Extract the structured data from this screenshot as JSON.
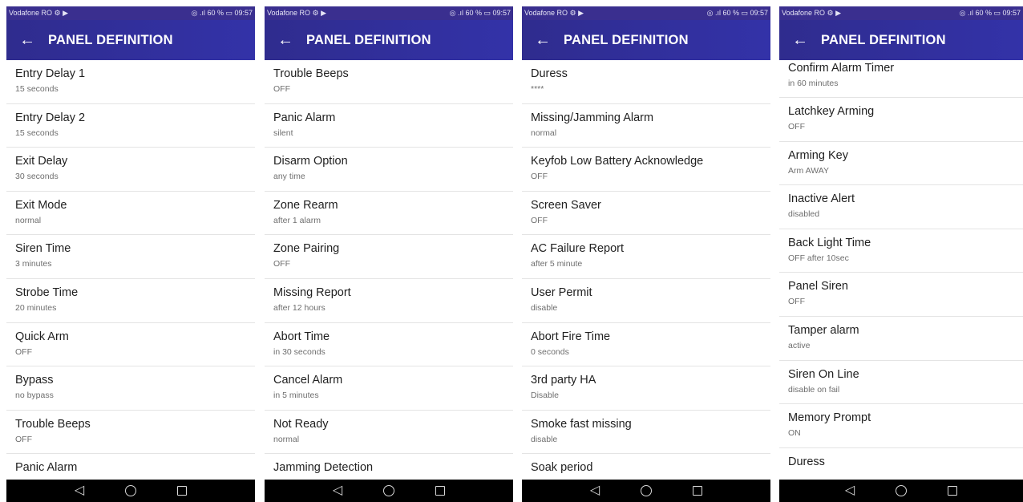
{
  "status": {
    "carrier": "Vodafone RO ⚙ ▶",
    "right": "◎ .ıl 60 % ▭ 09:57"
  },
  "appbar": {
    "title": "PANEL DEFINITION"
  },
  "screens": [
    {
      "items": [
        {
          "title": "Entry Delay 1",
          "value": "15 seconds"
        },
        {
          "title": "Entry Delay 2",
          "value": "15 seconds"
        },
        {
          "title": "Exit Delay",
          "value": "30 seconds"
        },
        {
          "title": "Exit Mode",
          "value": "normal"
        },
        {
          "title": "Siren Time",
          "value": "3 minutes"
        },
        {
          "title": "Strobe Time",
          "value": "20 minutes"
        },
        {
          "title": "Quick Arm",
          "value": "OFF"
        },
        {
          "title": "Bypass",
          "value": "no bypass"
        },
        {
          "title": "Trouble Beeps",
          "value": "OFF"
        },
        {
          "title": "Panic Alarm",
          "value": ""
        }
      ]
    },
    {
      "items": [
        {
          "title": "Trouble Beeps",
          "value": "OFF"
        },
        {
          "title": "Panic Alarm",
          "value": "silent"
        },
        {
          "title": "Disarm Option",
          "value": "any time"
        },
        {
          "title": "Zone Rearm",
          "value": "after 1 alarm"
        },
        {
          "title": "Zone Pairing",
          "value": "OFF"
        },
        {
          "title": "Missing Report",
          "value": "after 12 hours"
        },
        {
          "title": "Abort Time",
          "value": "in 30 seconds"
        },
        {
          "title": "Cancel Alarm",
          "value": "in 5 minutes"
        },
        {
          "title": "Not Ready",
          "value": "normal"
        },
        {
          "title": "Jamming Detection",
          "value": ""
        }
      ]
    },
    {
      "items": [
        {
          "title": "Duress",
          "value": "****"
        },
        {
          "title": "Missing/Jamming Alarm",
          "value": "normal"
        },
        {
          "title": "Keyfob Low Battery Acknowledge",
          "value": "OFF"
        },
        {
          "title": "Screen Saver",
          "value": "OFF"
        },
        {
          "title": "AC Failure Report",
          "value": "after 5 minute"
        },
        {
          "title": "User Permit",
          "value": "disable"
        },
        {
          "title": "Abort Fire Time",
          "value": "0 seconds"
        },
        {
          "title": "3rd party HA",
          "value": "Disable"
        },
        {
          "title": "Smoke fast missing",
          "value": "disable"
        },
        {
          "title": "Soak period",
          "value": ""
        }
      ]
    },
    {
      "items": [
        {
          "title": "Confirm Alarm Timer",
          "value": "in 60 minutes"
        },
        {
          "title": "Latchkey Arming",
          "value": "OFF"
        },
        {
          "title": "Arming Key",
          "value": "Arm AWAY"
        },
        {
          "title": "Inactive Alert",
          "value": "disabled"
        },
        {
          "title": "Back Light Time",
          "value": "OFF after 10sec"
        },
        {
          "title": "Panel Siren",
          "value": "OFF"
        },
        {
          "title": "Tamper alarm",
          "value": "active"
        },
        {
          "title": "Siren On Line",
          "value": "disable on fail"
        },
        {
          "title": "Memory Prompt",
          "value": "ON"
        },
        {
          "title": "Duress",
          "value": ""
        }
      ]
    }
  ],
  "navbar": {
    "back": "◁"
  }
}
